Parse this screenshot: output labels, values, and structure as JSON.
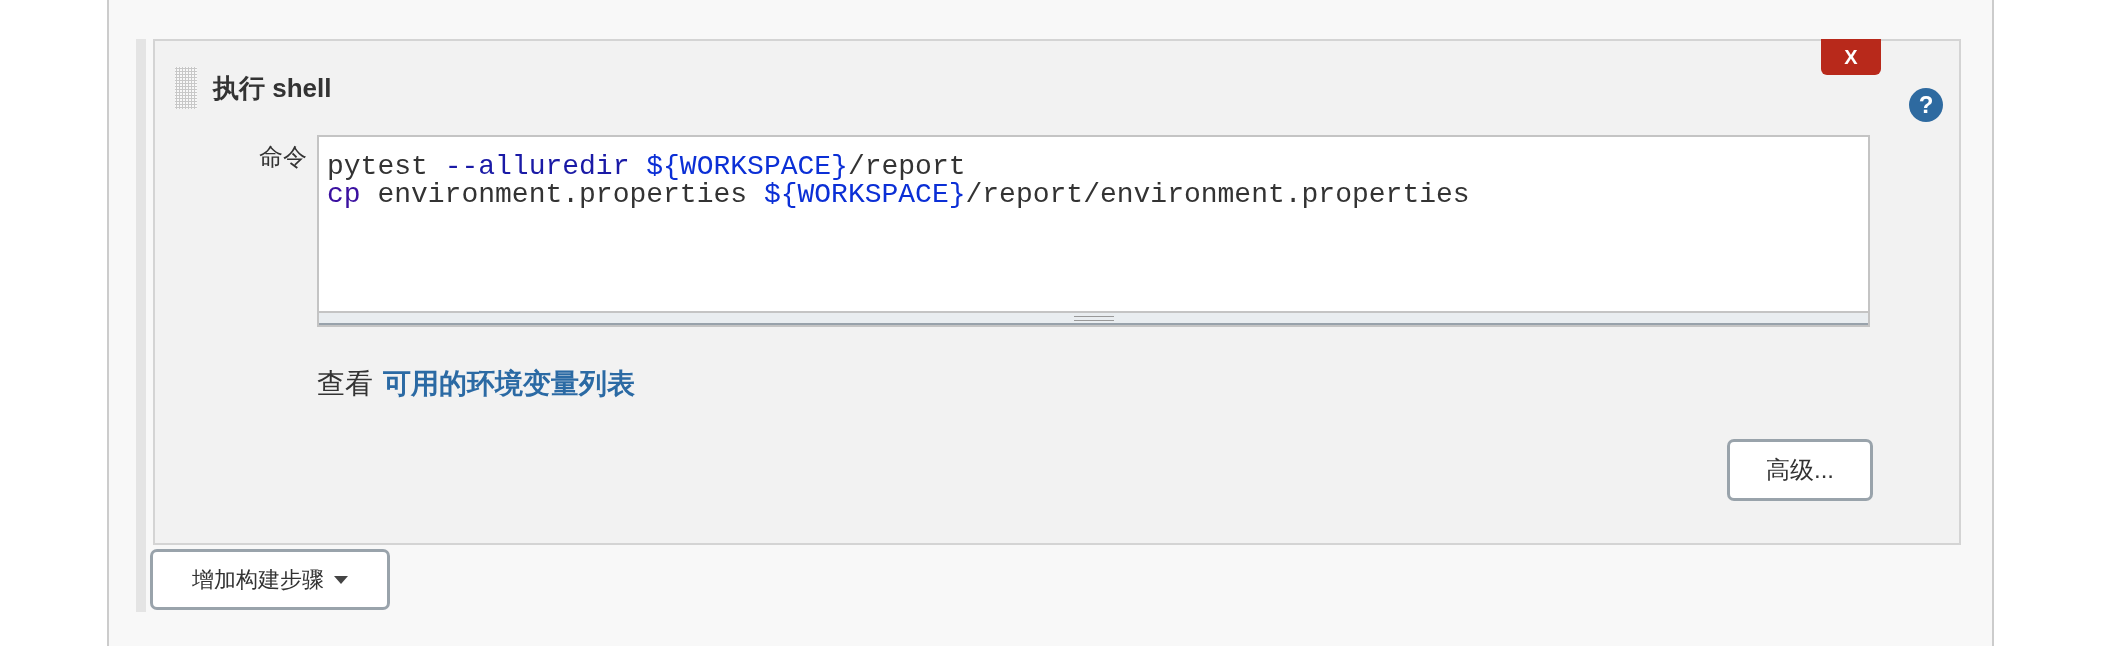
{
  "build_step": {
    "title": "执行 shell",
    "delete_label": "X",
    "help_label": "?",
    "command_label": "命令",
    "command_lines": [
      [
        {
          "kind": "plain",
          "text": "pytest "
        },
        {
          "kind": "option",
          "text": "--alluredir "
        },
        {
          "kind": "variable",
          "text": "${WORKSPACE}"
        },
        {
          "kind": "plain",
          "text": "/report"
        }
      ],
      [
        {
          "kind": "builtin",
          "text": "cp"
        },
        {
          "kind": "plain",
          "text": " environment.properties "
        },
        {
          "kind": "variable",
          "text": "${WORKSPACE}"
        },
        {
          "kind": "plain",
          "text": "/report/environment.properties"
        }
      ]
    ],
    "env_hint": "查看",
    "env_link": "可用的环境变量列表",
    "advanced_button": "高级..."
  },
  "add_step_button": "增加构建步骤"
}
